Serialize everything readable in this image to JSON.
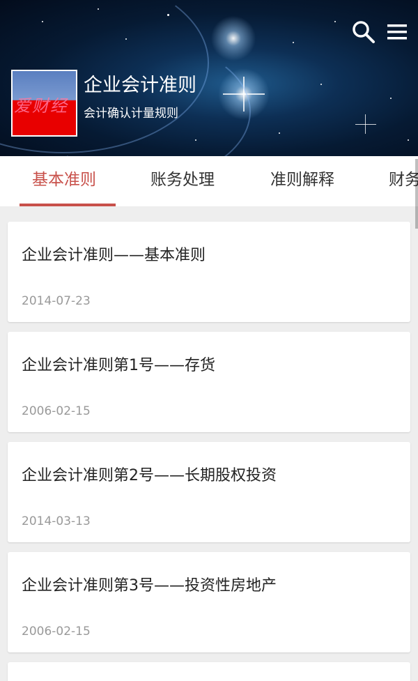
{
  "header": {
    "title": "企业会计准则",
    "subtitle": "会计确认计量规则",
    "logo_text": "爱财经",
    "search_icon": "search-icon",
    "menu_icon": "menu-icon"
  },
  "tabs": [
    {
      "label": "基本准则",
      "active": true
    },
    {
      "label": "账务处理",
      "active": false
    },
    {
      "label": "准则解释",
      "active": false
    },
    {
      "label": "财务",
      "active": false
    }
  ],
  "articles": [
    {
      "title": "企业会计准则——基本准则",
      "date": "2014-07-23"
    },
    {
      "title": "企业会计准则第1号——存货",
      "date": "2006-02-15"
    },
    {
      "title": "企业会计准则第2号——长期股权投资",
      "date": "2014-03-13"
    },
    {
      "title": "企业会计准则第3号——投资性房地产",
      "date": "2006-02-15"
    }
  ],
  "colors": {
    "accent": "#c8504a",
    "header_bg": "#0d2f55",
    "date_text": "#999999"
  }
}
